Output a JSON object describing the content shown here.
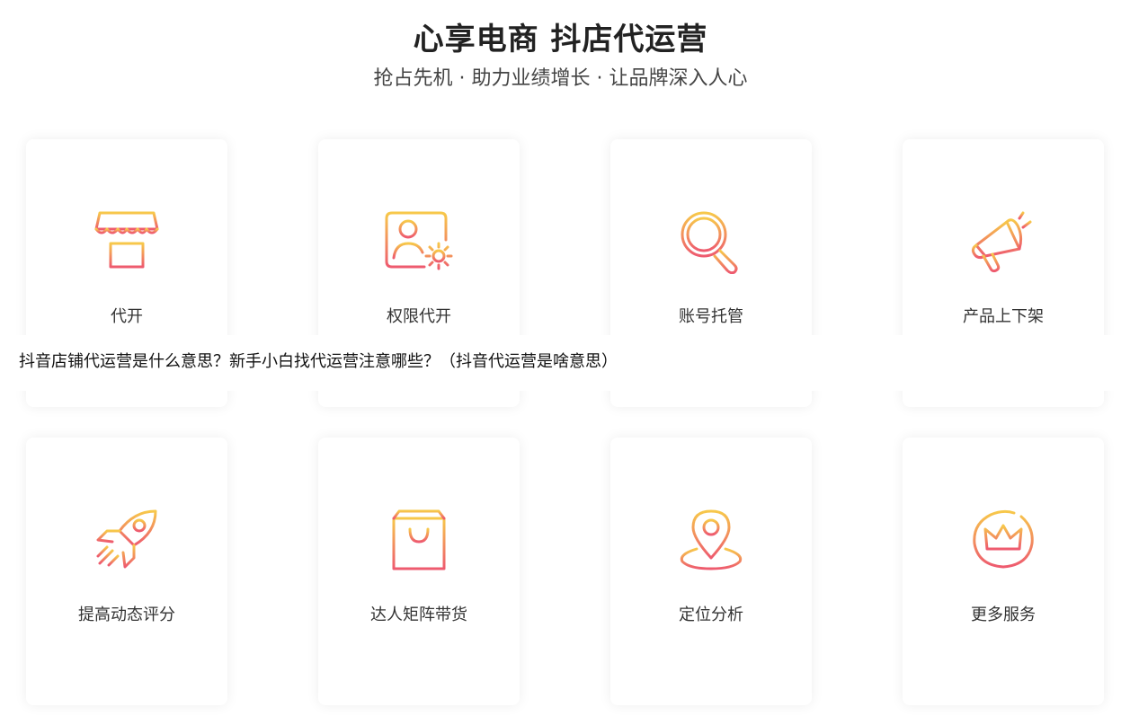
{
  "header": {
    "title": "心享电商 抖店代运营",
    "subtitle": "抢占先机 · 助力业绩增长 · 让品牌深入人心"
  },
  "services": [
    {
      "label": "代开",
      "icon": "storefront-icon"
    },
    {
      "label": "权限代开",
      "icon": "user-profile-gear-icon"
    },
    {
      "label": "账号托管",
      "icon": "chart-magnifier-icon"
    },
    {
      "label": "产品上下架",
      "icon": "megaphone-icon"
    },
    {
      "label": "提高动态评分",
      "icon": "rocket-icon"
    },
    {
      "label": "达人矩阵带货",
      "icon": "shopping-bag-icon"
    },
    {
      "label": "定位分析",
      "icon": "location-pin-icon"
    },
    {
      "label": "更多服务",
      "icon": "crown-icon"
    }
  ],
  "overlay": {
    "headline": "抖音店铺代运营是什么意思？新手小白找代运营注意哪些？（抖音代运营是啥意思）"
  },
  "colors": {
    "gradient_top": "#f7c84a",
    "gradient_bottom": "#ee5a6f",
    "card_bg": "#ffffff",
    "text": "#333333"
  }
}
